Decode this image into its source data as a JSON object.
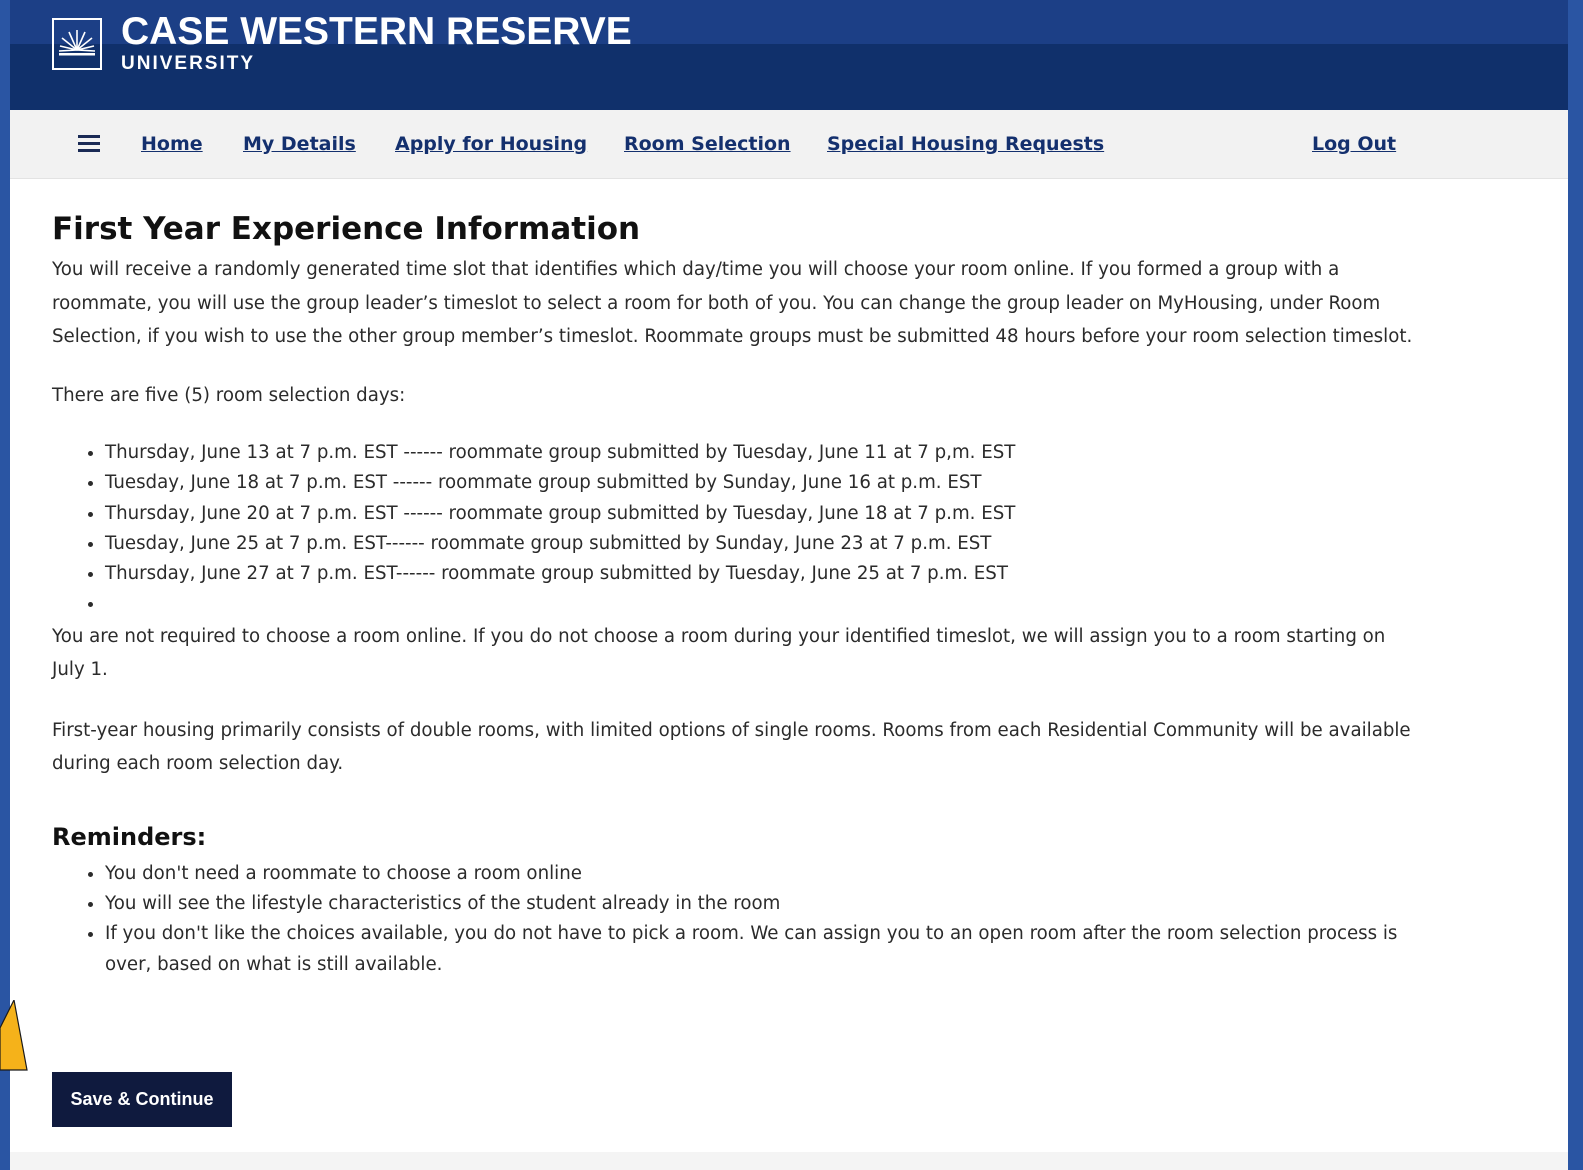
{
  "brand": {
    "title": "CASE WESTERN RESERVE",
    "subtitle": "UNIVERSITY"
  },
  "nav": {
    "home": "Home",
    "my_details": "My Details",
    "apply_for_housing": "Apply for Housing",
    "room_selection": "Room Selection",
    "special_housing_requests": "Special Housing Requests",
    "log_out": "Log Out"
  },
  "main": {
    "title": "First Year Experience Information",
    "intro": "You will receive a randomly generated time slot that identifies which day/time you will choose your room online. If you formed a group with a roommate, you will use the group leader’s timeslot to select a room for both of you. You can change the group leader on MyHousing, under Room Selection, if you wish to use the other group member’s timeslot. Roommate groups must be submitted 48 hours before your room selection timeslot.",
    "days_heading": "There are five (5) room selection days:",
    "days": [
      "Thursday, June 13 at 7 p.m. EST ------ roommate group submitted by Tuesday, June 11 at 7 p,m. EST",
      "Tuesday, June 18 at 7 p.m. EST ------ roommate group submitted by Sunday, June 16 at p.m. EST",
      "Thursday, June 20 at 7 p.m. EST ------ roommate group submitted by Tuesday, June 18 at 7 p.m. EST",
      "Tuesday, June 25 at 7 p.m. EST------ roommate group submitted by Sunday, June 23 at 7 p.m. EST",
      "Thursday, June 27 at 7 p.m. EST------ roommate group submitted by Tuesday, June 25 at 7 p.m. EST",
      ""
    ],
    "not_required": "You are not required to choose a room online. If you do not choose a room during your identified timeslot, we will assign you to a room starting on July 1.",
    "housing_info": "First-year housing primarily consists of double rooms, with limited options of single rooms. Rooms from each Residential Community will be available during each room selection day.",
    "reminders_title": "Reminders:",
    "reminders": [
      "You don't need a roommate to choose a room online",
      "You will see the lifestyle characteristics of the student already in the room",
      "If you don't like the choices available, you do not have to pick a room. We can assign you to an open room after the room selection process is over, based on what is still available."
    ]
  },
  "actions": {
    "save_continue": "Save & Continue"
  },
  "colors": {
    "header_top": "#1c3f86",
    "header_bottom": "#10306b",
    "nav_link": "#14306e",
    "button": "#0f1a3e",
    "arrow": "#f5b21a"
  }
}
